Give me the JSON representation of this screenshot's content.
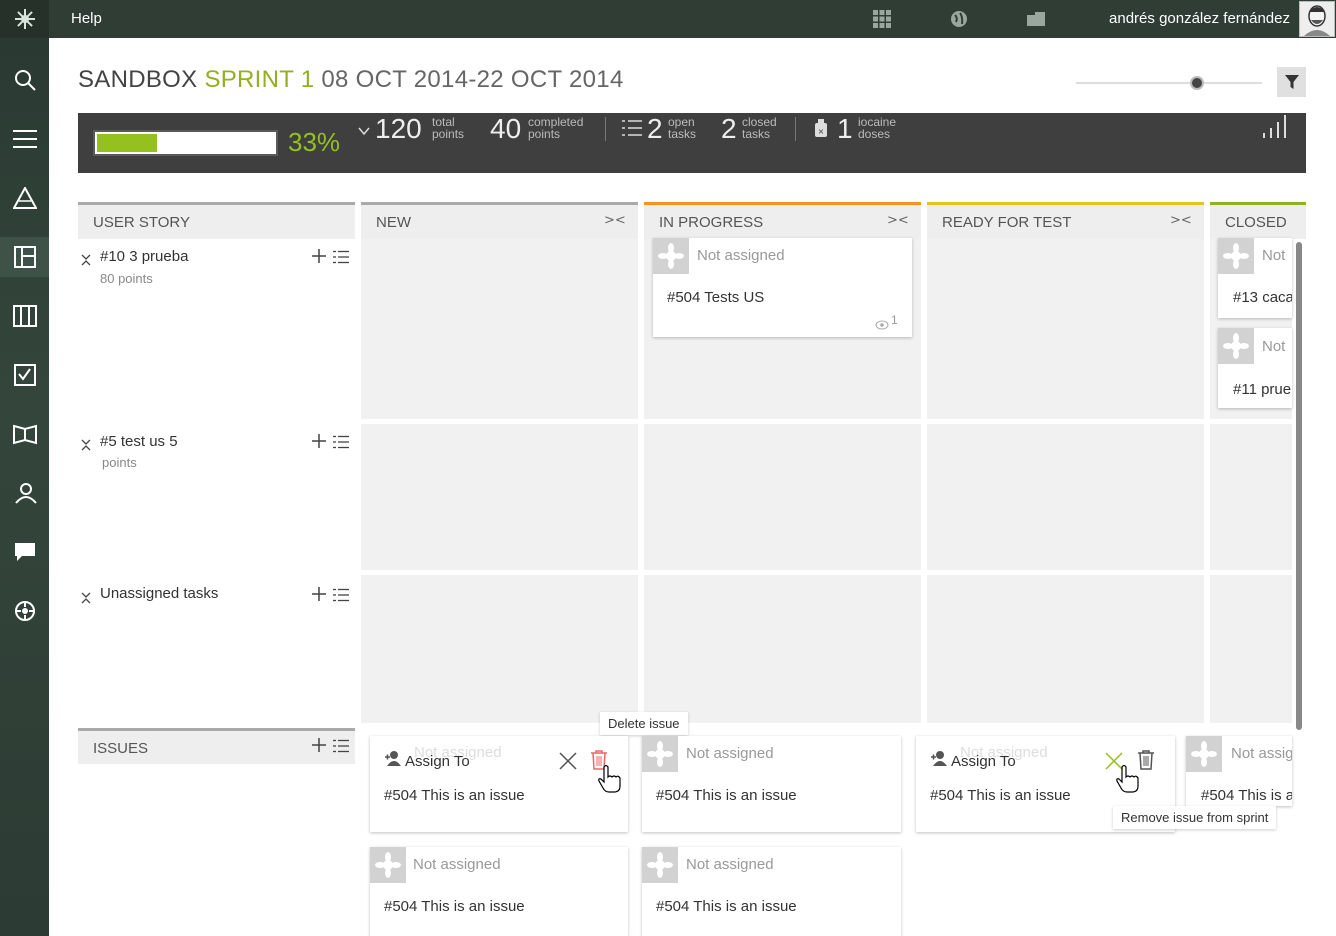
{
  "topbar": {
    "help": "Help",
    "username": "andrés gonzález fernández"
  },
  "sidebar": [
    "search-icon",
    "backlog-icon",
    "epics-icon",
    "taskboard-icon",
    "kanban-icon",
    "issues-icon",
    "wiki-icon",
    "team-icon",
    "chat-icon",
    "admin-icon"
  ],
  "title": {
    "project": "SANDBOX",
    "sprint": "SPRINT 1",
    "dates": "08 OCT 2014-22 OCT 2014"
  },
  "stats": {
    "progress_pct": 33,
    "percent": "33%",
    "total_points": "120",
    "total_label1": "total",
    "total_label2": "points",
    "completed_points": "40",
    "completed_label1": "completed",
    "completed_label2": "points",
    "open_tasks": "2",
    "open_label1": "open",
    "open_label2": "tasks",
    "closed_tasks": "2",
    "closed_label1": "closed",
    "closed_label2": "tasks",
    "iocaine": "1",
    "iocaine_label1": "iocaine",
    "iocaine_label2": "doses"
  },
  "columns": {
    "user_story": "USER STORY",
    "new": "NEW",
    "in_progress": "IN PROGRESS",
    "ready_for_test": "READY FOR TEST",
    "closed": "CLOSED"
  },
  "colors": {
    "new": "#aaaaaa",
    "in_progress": "#f7941e",
    "ready_for_test": "#e8c51c",
    "closed": "#8fb21e"
  },
  "rows": [
    {
      "title": "#10 3 prueba",
      "points": "80 points"
    },
    {
      "title": "#5 test us 5",
      "points": "points"
    },
    {
      "title": "Unassigned tasks",
      "points": ""
    }
  ],
  "cards": {
    "inprogress": {
      "assignee": "Not assigned",
      "title": "#504 Tests US",
      "watchers": "1"
    },
    "closed1": {
      "assignee": "Not",
      "title": "#13 caca"
    },
    "closed2": {
      "assignee": "Not",
      "title": "#11 prue"
    }
  },
  "issues": {
    "label": "ISSUES",
    "assign_to": "Assign To",
    "faint": "Not assigned",
    "cards": [
      {
        "assignee": "Not assigned",
        "title": "#504 This is an issue"
      },
      {
        "assignee": "Not assigned",
        "title": "#504 This is an issue"
      },
      {
        "assignee": "Not assigned",
        "title": "#504 This is an issue"
      },
      {
        "assignee": "Not assig",
        "title": "#504 This is a"
      },
      {
        "assignee": "Not assigned",
        "title": "#504 This is an issue"
      },
      {
        "assignee": "Not assigned",
        "title": "#504 This is an issue"
      }
    ],
    "tooltip_delete": "Delete issue",
    "tooltip_remove": "Remove issue from sprint"
  }
}
